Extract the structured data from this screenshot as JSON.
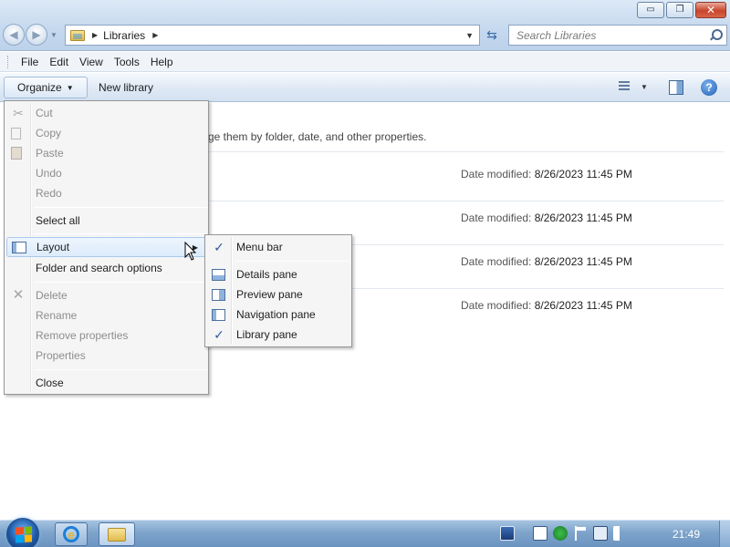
{
  "window": {
    "caption": {
      "minimize": "▭",
      "maximize": "❐",
      "close": "✕"
    }
  },
  "address": {
    "crumb": "Libraries"
  },
  "search": {
    "placeholder": "Search Libraries"
  },
  "menubar": [
    "File",
    "Edit",
    "View",
    "Tools",
    "Help"
  ],
  "commandbar": {
    "organize": "Organize",
    "new_library": "New library"
  },
  "content": {
    "description": "ge them by folder, date, and other properties.",
    "rows": [
      {
        "date_label": "Date modified:",
        "date": "8/26/2023 11:45 PM"
      },
      {
        "date_label": "Date modified:",
        "date": "8/26/2023 11:45 PM"
      },
      {
        "date_label": "Date modified:",
        "date": "8/26/2023 11:45 PM"
      },
      {
        "date_label": "Date modified:",
        "date": "8/26/2023 11:45 PM"
      }
    ]
  },
  "organize_menu": {
    "cut": "Cut",
    "copy": "Copy",
    "paste": "Paste",
    "undo": "Undo",
    "redo": "Redo",
    "select_all": "Select all",
    "layout": "Layout",
    "folder_options": "Folder and search options",
    "delete": "Delete",
    "rename": "Rename",
    "remove_properties": "Remove properties",
    "properties": "Properties",
    "close": "Close"
  },
  "layout_submenu": {
    "menu_bar": "Menu bar",
    "details_pane": "Details pane",
    "preview_pane": "Preview pane",
    "navigation_pane": "Navigation pane",
    "library_pane": "Library pane",
    "checked": [
      "Menu bar",
      "Library pane"
    ]
  },
  "taskbar": {
    "clock": "21:49"
  },
  "colors": {
    "accent": "#2b5a9a",
    "taskbar": "#7ea4cb"
  }
}
